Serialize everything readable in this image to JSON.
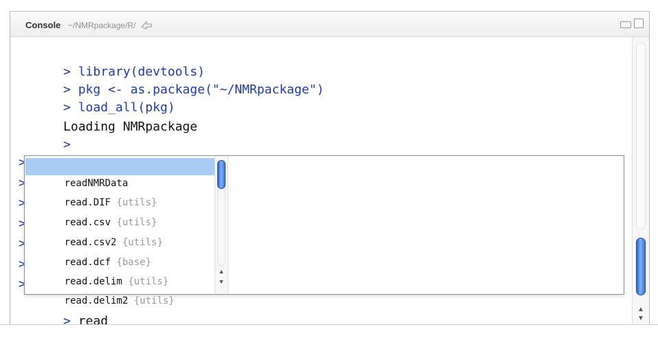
{
  "titlebar": {
    "title": "Console",
    "path": "~/NMRpackage/R/"
  },
  "console": {
    "prompt": ">",
    "lines": [
      {
        "text": "library(devtools)"
      },
      {
        "text": "pkg <- as.package(\"~/NMRpackage\")"
      },
      {
        "text": "load_all(pkg)"
      }
    ],
    "output": "Loading NMRpackage",
    "current_input": "read"
  },
  "autocomplete": {
    "items": [
      {
        "name": "readNMRData",
        "pkg": ""
      },
      {
        "name": "read.DIF",
        "pkg": "{utils}"
      },
      {
        "name": "read.csv",
        "pkg": "{utils}"
      },
      {
        "name": "read.csv2",
        "pkg": "{utils}"
      },
      {
        "name": "read.dcf",
        "pkg": "{base}"
      },
      {
        "name": "read.delim",
        "pkg": "{utils}"
      },
      {
        "name": "read.delim2",
        "pkg": "{utils}"
      }
    ],
    "selected_index": 0
  }
}
